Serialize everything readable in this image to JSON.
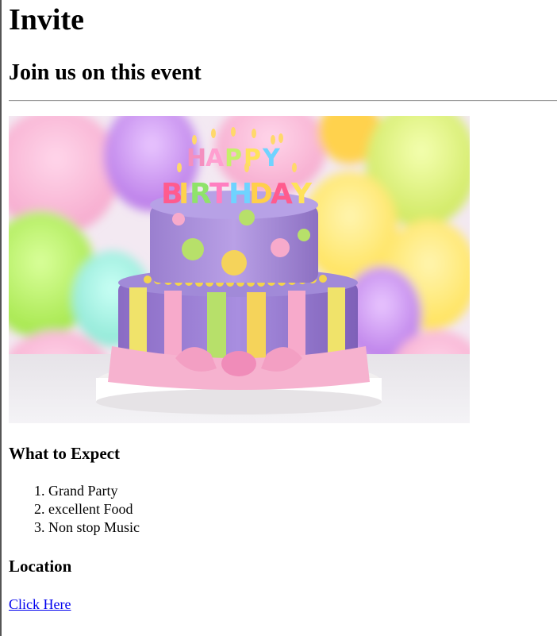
{
  "page": {
    "title": "Invite",
    "subtitle": "Join us on this event"
  },
  "hero": {
    "cake_text": "HAPPY BIRTHDAY"
  },
  "expect": {
    "heading": "What to Expect",
    "items": [
      "Grand Party",
      "excellent Food",
      "Non stop Music"
    ]
  },
  "location": {
    "heading": "Location",
    "link_label": "Click Here"
  },
  "colors": {
    "link": "#0000ee",
    "divider": "#9a9a9a"
  }
}
